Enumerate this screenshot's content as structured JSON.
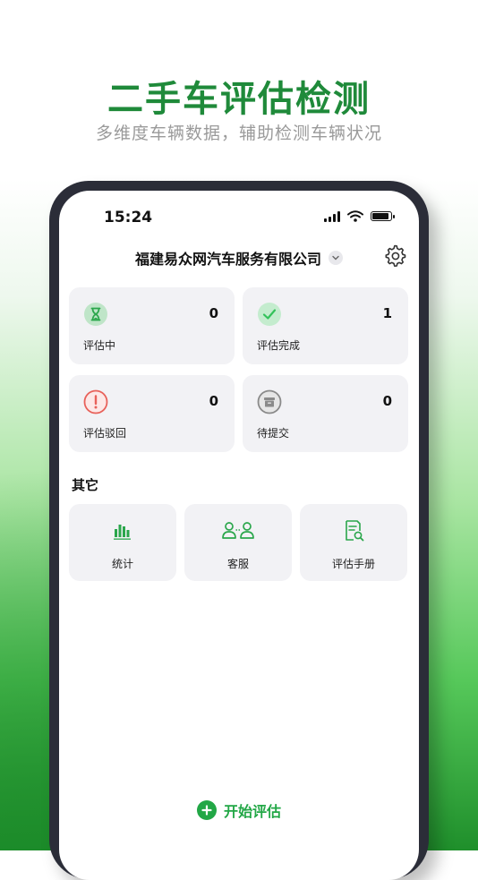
{
  "hero": {
    "title": "二手车评估检测",
    "subtitle": "多维度车辆数据，辅助检测车辆状况"
  },
  "status_bar": {
    "time": "15:24",
    "icons": [
      "signal-icon",
      "wifi-icon",
      "battery-icon"
    ]
  },
  "header": {
    "company": "福建易众网汽车服务有限公司",
    "icons": [
      "chevron-down-icon",
      "gear-icon"
    ]
  },
  "stats": [
    {
      "label": "评估中",
      "count": "0",
      "icon": "hourglass-icon",
      "color": "#2aa64b"
    },
    {
      "label": "评估完成",
      "count": "1",
      "icon": "check-icon",
      "color": "#33c25a"
    },
    {
      "label": "评估驳回",
      "count": "0",
      "icon": "alert-icon",
      "color": "#e8615a"
    },
    {
      "label": "待提交",
      "count": "0",
      "icon": "archive-icon",
      "color": "#8a8a8a"
    }
  ],
  "others": {
    "title": "其它",
    "items": [
      {
        "label": "统计",
        "icon": "bar-chart-icon"
      },
      {
        "label": "客服",
        "icon": "customer-service-icon"
      },
      {
        "label": "评估手册",
        "icon": "manual-search-icon"
      }
    ]
  },
  "actions": {
    "start_label": "开始评估",
    "icon": "plus-circle-icon"
  },
  "colors": {
    "accent": "#22a746",
    "title_green": "#1f8a3a"
  }
}
